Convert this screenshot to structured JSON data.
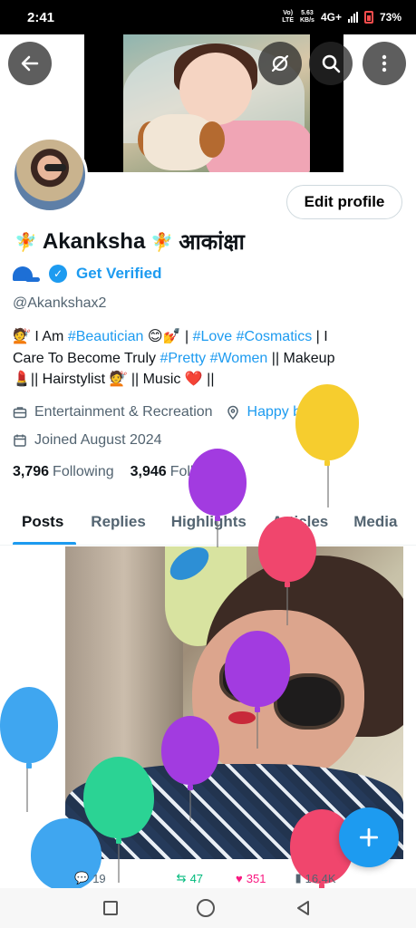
{
  "status_bar": {
    "time": "2:41",
    "volte_top": "Vo)",
    "volte_bottom": "LTE",
    "speed_value": "5.63",
    "speed_unit": "KB/s",
    "network": "4G+",
    "battery": "73%"
  },
  "colors": {
    "accent": "#1d9bf0",
    "text_primary": "#0f1419",
    "text_secondary": "#536471",
    "retweet": "#00ba7c",
    "like": "#f91880"
  },
  "header": {
    "back_icon": "arrow-left-icon",
    "top_right_icons": [
      "eye-slash-icon",
      "search-icon",
      "more-vertical-icon"
    ]
  },
  "profile": {
    "edit_profile_label": "Edit profile",
    "name_left_emoji": "🧚",
    "name": "Akanksha",
    "name_right_emoji": "🧚",
    "name_hindi": "आकांक्षा",
    "verified_cap_icon": "cap-icon",
    "get_verified_label": "Get Verified",
    "handle": "@Akankshax2",
    "bio": {
      "line1_prefix": "💇 I Am",
      "tag_beautician": "#Beautician",
      "line1_emojis": "😊💅",
      "sep1": "|",
      "tag_love": "#Love",
      "tag_cosmatics": "#Cosmatics",
      "line1_suffix": "|  I",
      "line2_prefix": "Care To Become Truly",
      "tag_pretty": "#Pretty",
      "tag_women": "#Women",
      "line2_suffix": "  || Makeup",
      "line3": "💄|| Hairstylist 💇 || Music ❤️ ||"
    },
    "category": "Entertainment & Recreation",
    "location_link": "Happy birthday!",
    "joined": "Joined August 2024",
    "following_count": "3,796",
    "following_label": "Following",
    "followers_count": "3,946",
    "followers_label": "Followers"
  },
  "tabs": [
    {
      "label": "Posts",
      "active": true
    },
    {
      "label": "Replies",
      "active": false
    },
    {
      "label": "Highlights",
      "active": false
    },
    {
      "label": "Articles",
      "active": false
    },
    {
      "label": "Media",
      "active": false
    }
  ],
  "post": {
    "replies": "19",
    "retweets": "47",
    "likes": "351",
    "views": "16.4K"
  },
  "fab_icon": "plus-icon",
  "nav": [
    "recents-icon",
    "home-icon",
    "back-icon"
  ]
}
